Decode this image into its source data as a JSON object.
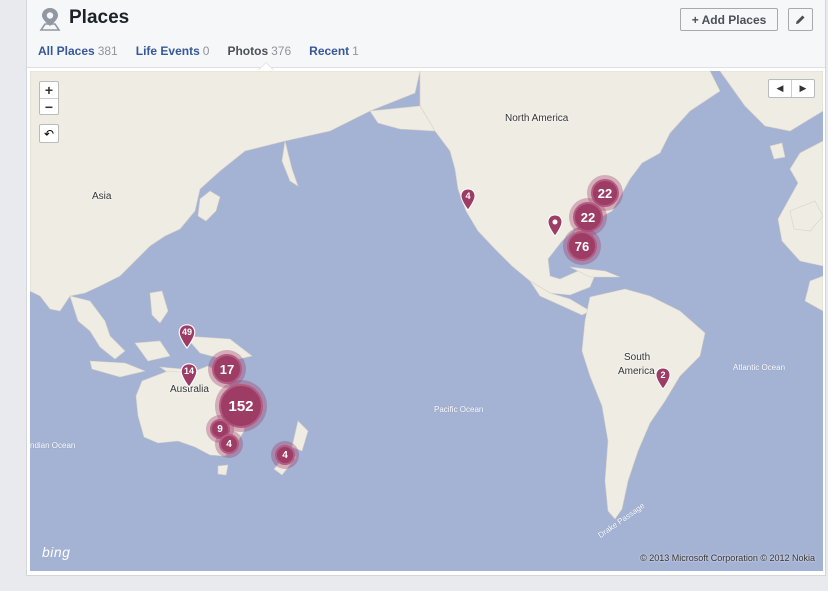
{
  "header": {
    "title": "Places",
    "add_label": "+ Add Places",
    "title_icon": "map-pin-icon",
    "edit_icon": "pencil-icon"
  },
  "tabs": [
    {
      "label": "All Places",
      "count": "381"
    },
    {
      "label": "Life Events",
      "count": "0"
    },
    {
      "label": "Photos",
      "count": "376",
      "active": true
    },
    {
      "label": "Recent",
      "count": "1"
    }
  ],
  "map": {
    "zoom_in": "+",
    "zoom_out": "−",
    "reset": "↶",
    "prev": "◀",
    "next": "▶",
    "labels": {
      "north_america": "North America",
      "asia": "Asia",
      "south_america_1": "South",
      "south_america_2": "America",
      "australia": "Australia",
      "pacific": "Pacific Ocean",
      "atlantic": "Atlantic Ocean",
      "indian": "ndian Ocean",
      "drake": "Drake Passage"
    },
    "clusters": [
      "22",
      "22",
      "76",
      "17",
      "152",
      "9",
      "4",
      "4"
    ],
    "pins": [
      "4",
      "",
      "49",
      "14",
      "2"
    ],
    "logo": "bing",
    "copyright": "© 2013 Microsoft Corporation   © 2012 Nokia"
  },
  "colors": {
    "ocean": "#a4b2d4",
    "land": "#efece4",
    "marker": "#9d3d66",
    "link": "#365899"
  }
}
